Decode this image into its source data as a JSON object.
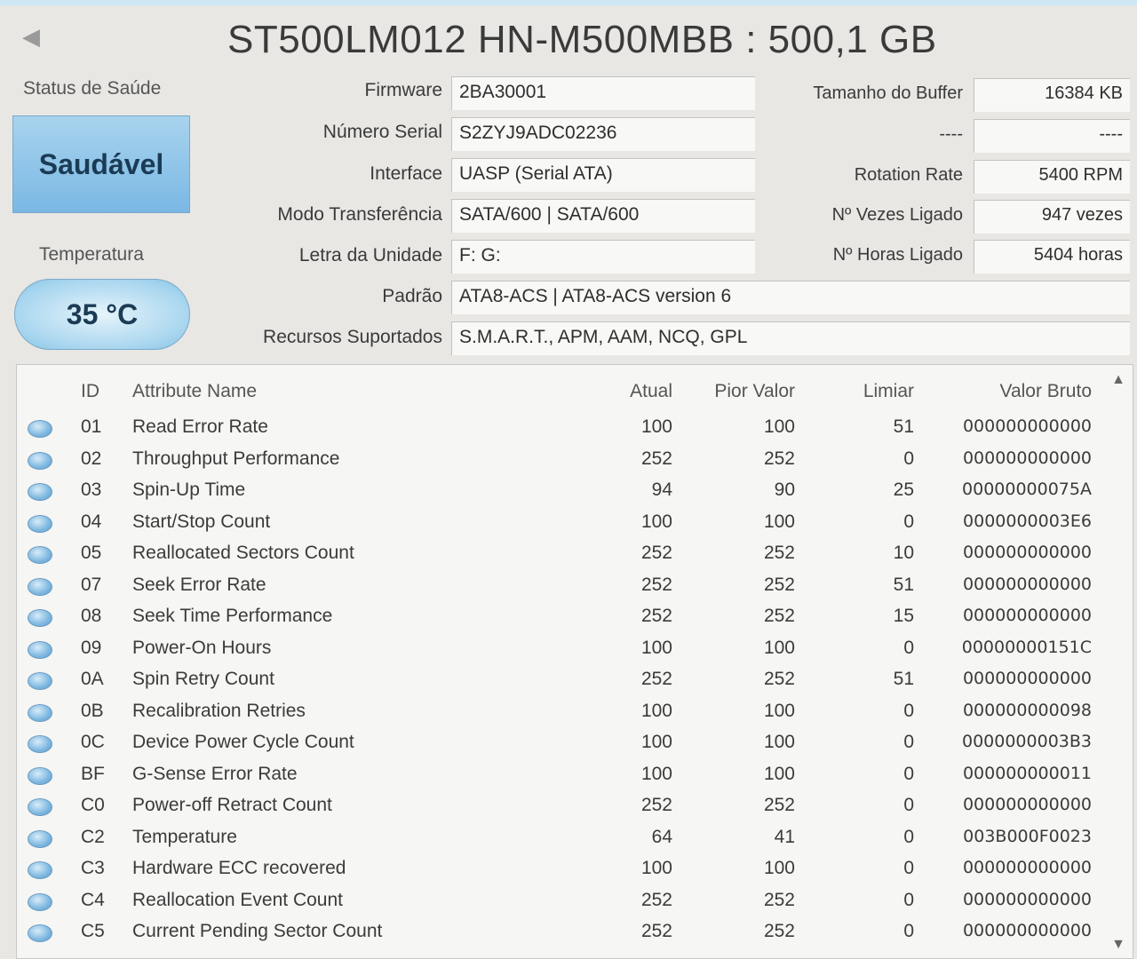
{
  "title": "ST500LM012 HN-M500MBB : 500,1 GB",
  "back_glyph": "◀",
  "health": {
    "label": "Status de Saúde",
    "value": "Saudável",
    "color": "#8cc4ea"
  },
  "temperature": {
    "label": "Temperatura",
    "value": "35 °C"
  },
  "info": {
    "firmware": {
      "label": "Firmware",
      "value": "2BA30001"
    },
    "serial": {
      "label": "Número Serial",
      "value": "S2ZYJ9ADC02236"
    },
    "interface": {
      "label": "Interface",
      "value": "UASP (Serial ATA)"
    },
    "transfer": {
      "label": "Modo Transferência",
      "value": "SATA/600 | SATA/600"
    },
    "drive_letter": {
      "label": "Letra da Unidade",
      "value": "F: G:"
    },
    "standard": {
      "label": "Padrão",
      "value": "ATA8-ACS | ATA8-ACS version 6"
    },
    "features": {
      "label": "Recursos Suportados",
      "value": "S.M.A.R.T., APM, AAM, NCQ, GPL"
    }
  },
  "right_info": {
    "buffer": {
      "label": "Tamanho do Buffer",
      "value": "16384 KB"
    },
    "blank": {
      "label": "----",
      "value": "----"
    },
    "rotation": {
      "label": "Rotation Rate",
      "value": "5400 RPM"
    },
    "power_count": {
      "label": "Nº Vezes Ligado",
      "value": "947 vezes"
    },
    "power_hours": {
      "label": "Nº Horas Ligado",
      "value": "5404 horas"
    }
  },
  "table": {
    "headers": {
      "id": "ID",
      "name": "Attribute Name",
      "atual": "Atual",
      "pior": "Pior Valor",
      "limiar": "Limiar",
      "raw": "Valor Bruto"
    },
    "rows": [
      {
        "id": "01",
        "name": "Read Error Rate",
        "atual": "100",
        "pior": "100",
        "limiar": "51",
        "raw": "000000000000"
      },
      {
        "id": "02",
        "name": "Throughput Performance",
        "atual": "252",
        "pior": "252",
        "limiar": "0",
        "raw": "000000000000"
      },
      {
        "id": "03",
        "name": "Spin-Up Time",
        "atual": "94",
        "pior": "90",
        "limiar": "25",
        "raw": "00000000075A"
      },
      {
        "id": "04",
        "name": "Start/Stop Count",
        "atual": "100",
        "pior": "100",
        "limiar": "0",
        "raw": "0000000003E6"
      },
      {
        "id": "05",
        "name": "Reallocated Sectors Count",
        "atual": "252",
        "pior": "252",
        "limiar": "10",
        "raw": "000000000000"
      },
      {
        "id": "07",
        "name": "Seek Error Rate",
        "atual": "252",
        "pior": "252",
        "limiar": "51",
        "raw": "000000000000"
      },
      {
        "id": "08",
        "name": "Seek Time Performance",
        "atual": "252",
        "pior": "252",
        "limiar": "15",
        "raw": "000000000000"
      },
      {
        "id": "09",
        "name": "Power-On Hours",
        "atual": "100",
        "pior": "100",
        "limiar": "0",
        "raw": "00000000151C"
      },
      {
        "id": "0A",
        "name": "Spin Retry Count",
        "atual": "252",
        "pior": "252",
        "limiar": "51",
        "raw": "000000000000"
      },
      {
        "id": "0B",
        "name": "Recalibration Retries",
        "atual": "100",
        "pior": "100",
        "limiar": "0",
        "raw": "000000000098"
      },
      {
        "id": "0C",
        "name": "Device Power Cycle Count",
        "atual": "100",
        "pior": "100",
        "limiar": "0",
        "raw": "0000000003B3"
      },
      {
        "id": "BF",
        "name": "G-Sense Error Rate",
        "atual": "100",
        "pior": "100",
        "limiar": "0",
        "raw": "000000000011"
      },
      {
        "id": "C0",
        "name": "Power-off Retract Count",
        "atual": "252",
        "pior": "252",
        "limiar": "0",
        "raw": "000000000000"
      },
      {
        "id": "C2",
        "name": "Temperature",
        "atual": "64",
        "pior": "41",
        "limiar": "0",
        "raw": "003B000F0023"
      },
      {
        "id": "C3",
        "name": "Hardware ECC recovered",
        "atual": "100",
        "pior": "100",
        "limiar": "0",
        "raw": "000000000000"
      },
      {
        "id": "C4",
        "name": "Reallocation Event Count",
        "atual": "252",
        "pior": "252",
        "limiar": "0",
        "raw": "000000000000"
      },
      {
        "id": "C5",
        "name": "Current Pending Sector Count",
        "atual": "252",
        "pior": "252",
        "limiar": "0",
        "raw": "000000000000"
      }
    ]
  }
}
